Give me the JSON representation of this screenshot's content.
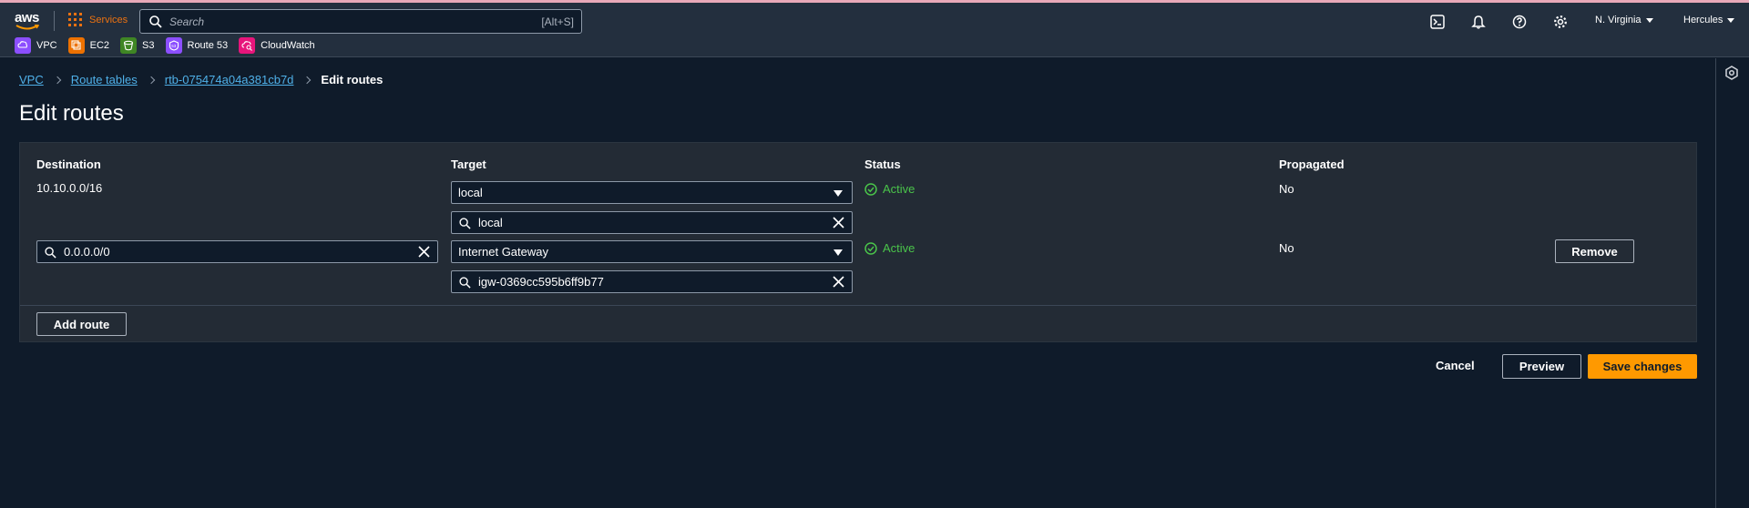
{
  "topnav": {
    "logo_text": "aws",
    "services_label": "Services",
    "search_placeholder": "Search",
    "search_shortcut": "[Alt+S]",
    "region": "N. Virginia",
    "user": "Hercules"
  },
  "favorites": [
    {
      "label": "VPC",
      "color": "#8c4fff"
    },
    {
      "label": "EC2",
      "color": "#ed7100"
    },
    {
      "label": "S3",
      "color": "#3f8624"
    },
    {
      "label": "Route 53",
      "color": "#8c4fff"
    },
    {
      "label": "CloudWatch",
      "color": "#e7157b"
    }
  ],
  "breadcrumb": {
    "items": [
      "VPC",
      "Route tables",
      "rtb-075474a04a381cb7d"
    ],
    "current": "Edit routes"
  },
  "page_title": "Edit routes",
  "table": {
    "headers": {
      "destination": "Destination",
      "target": "Target",
      "status": "Status",
      "propagated": "Propagated"
    },
    "rows": [
      {
        "destination": "10.10.0.0/16",
        "target_type": "local",
        "target_value": "local",
        "status": "Active",
        "propagated": "No"
      },
      {
        "destination": "0.0.0.0/0",
        "target_type": "Internet Gateway",
        "target_value": "igw-0369cc595b6ff9b77",
        "status": "Active",
        "propagated": "No",
        "remove_label": "Remove"
      }
    ],
    "add_route_label": "Add route"
  },
  "footer": {
    "cancel_label": "Cancel",
    "preview_label": "Preview",
    "save_label": "Save changes"
  },
  "colors": {
    "accent": "#ff9900",
    "link": "#4fb0e8",
    "status_active": "#4ac44a",
    "services": "#ec7211"
  }
}
